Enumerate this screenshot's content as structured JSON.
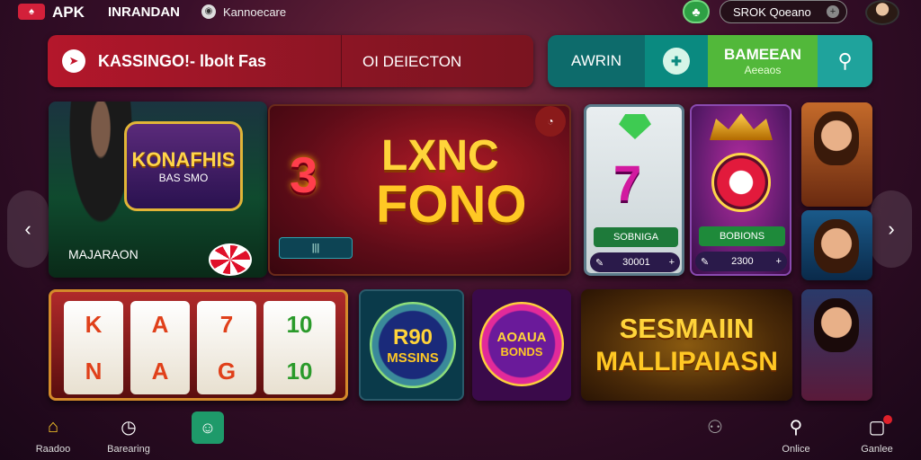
{
  "header": {
    "brand": "APK",
    "brand_secondary": "INRANDAN",
    "subtitle": "Kannoecare",
    "account_label": "SROK Qoeano"
  },
  "search": {
    "title": "KASSINGO!- lbolt Fas",
    "select_label": "OI DEIECTON"
  },
  "actions": {
    "awin_label": "AWRIN",
    "promo_title": "BAMEEAN",
    "promo_sub": "Aeeaos"
  },
  "featured": {
    "card1": {
      "crest_title": "KONAFHIS",
      "crest_sub": "BAS SMO",
      "label": "MAJARAON"
    },
    "card2": {
      "big_number": "3",
      "title_1": "LXNC",
      "title_2": "FONO",
      "mini_label": "|||"
    },
    "card3": {
      "number": "7",
      "button": "SOBNIGA",
      "amount": "30001"
    },
    "card4": {
      "button": "BOBIONS",
      "amount": "2300"
    }
  },
  "games": {
    "slots_reels": [
      [
        "K",
        "N"
      ],
      [
        "A",
        "A"
      ],
      [
        "7",
        "G"
      ],
      [
        "10",
        "10"
      ]
    ],
    "bonus1": {
      "a": "R90",
      "b": "MSSINS"
    },
    "bonus2": {
      "a": "AOAUA",
      "b": "BONDS"
    },
    "promo": {
      "line1": "SESMAIIN",
      "line2": "MALLIPAIASN"
    }
  },
  "nav": [
    {
      "label": "Raadoo",
      "icon": "home-icon"
    },
    {
      "label": "Barearing",
      "icon": "clock-icon"
    },
    {
      "label": "",
      "icon": "bot-icon"
    },
    {
      "label": "",
      "icon": "cherries-icon"
    },
    {
      "label": "Onlice",
      "icon": "search-icon"
    },
    {
      "label": "Ganlee",
      "icon": "chat-icon"
    }
  ],
  "colors": {
    "accent_red": "#b4172b",
    "accent_teal": "#0d6b6b",
    "accent_green": "#52b83a"
  }
}
